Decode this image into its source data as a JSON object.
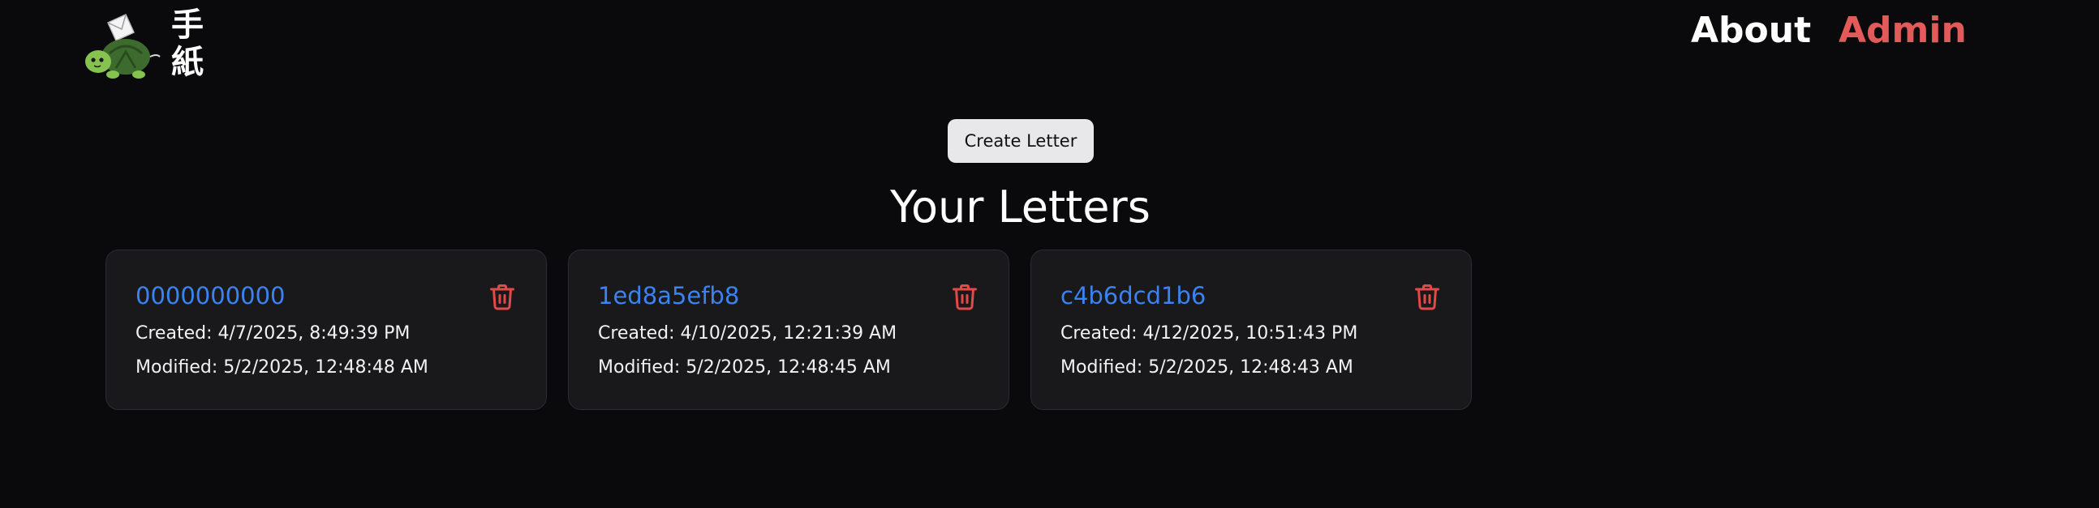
{
  "header": {
    "logo_kanji_top": "手",
    "logo_kanji_bottom": "紙",
    "nav": {
      "about_label": "About",
      "admin_label": "Admin"
    },
    "colors": {
      "admin": "#e25a5a"
    }
  },
  "main": {
    "create_button_label": "Create Letter",
    "title": "Your Letters",
    "letters": [
      {
        "id": "0000000000",
        "created": "Created: 4/7/2025, 8:49:39 PM",
        "modified": "Modified: 5/2/2025, 12:48:48 AM",
        "delete_icon": "trash-icon"
      },
      {
        "id": "1ed8a5efb8",
        "created": "Created: 4/10/2025, 12:21:39 AM",
        "modified": "Modified: 5/2/2025, 12:48:45 AM",
        "delete_icon": "trash-icon"
      },
      {
        "id": "c4b6dcd1b6",
        "created": "Created: 4/12/2025, 10:51:43 PM",
        "modified": "Modified: 5/2/2025, 12:48:43 AM",
        "delete_icon": "trash-icon"
      }
    ],
    "colors": {
      "link": "#3a83f0",
      "delete": "#e24a4a",
      "card_bg": "#19191c"
    }
  }
}
